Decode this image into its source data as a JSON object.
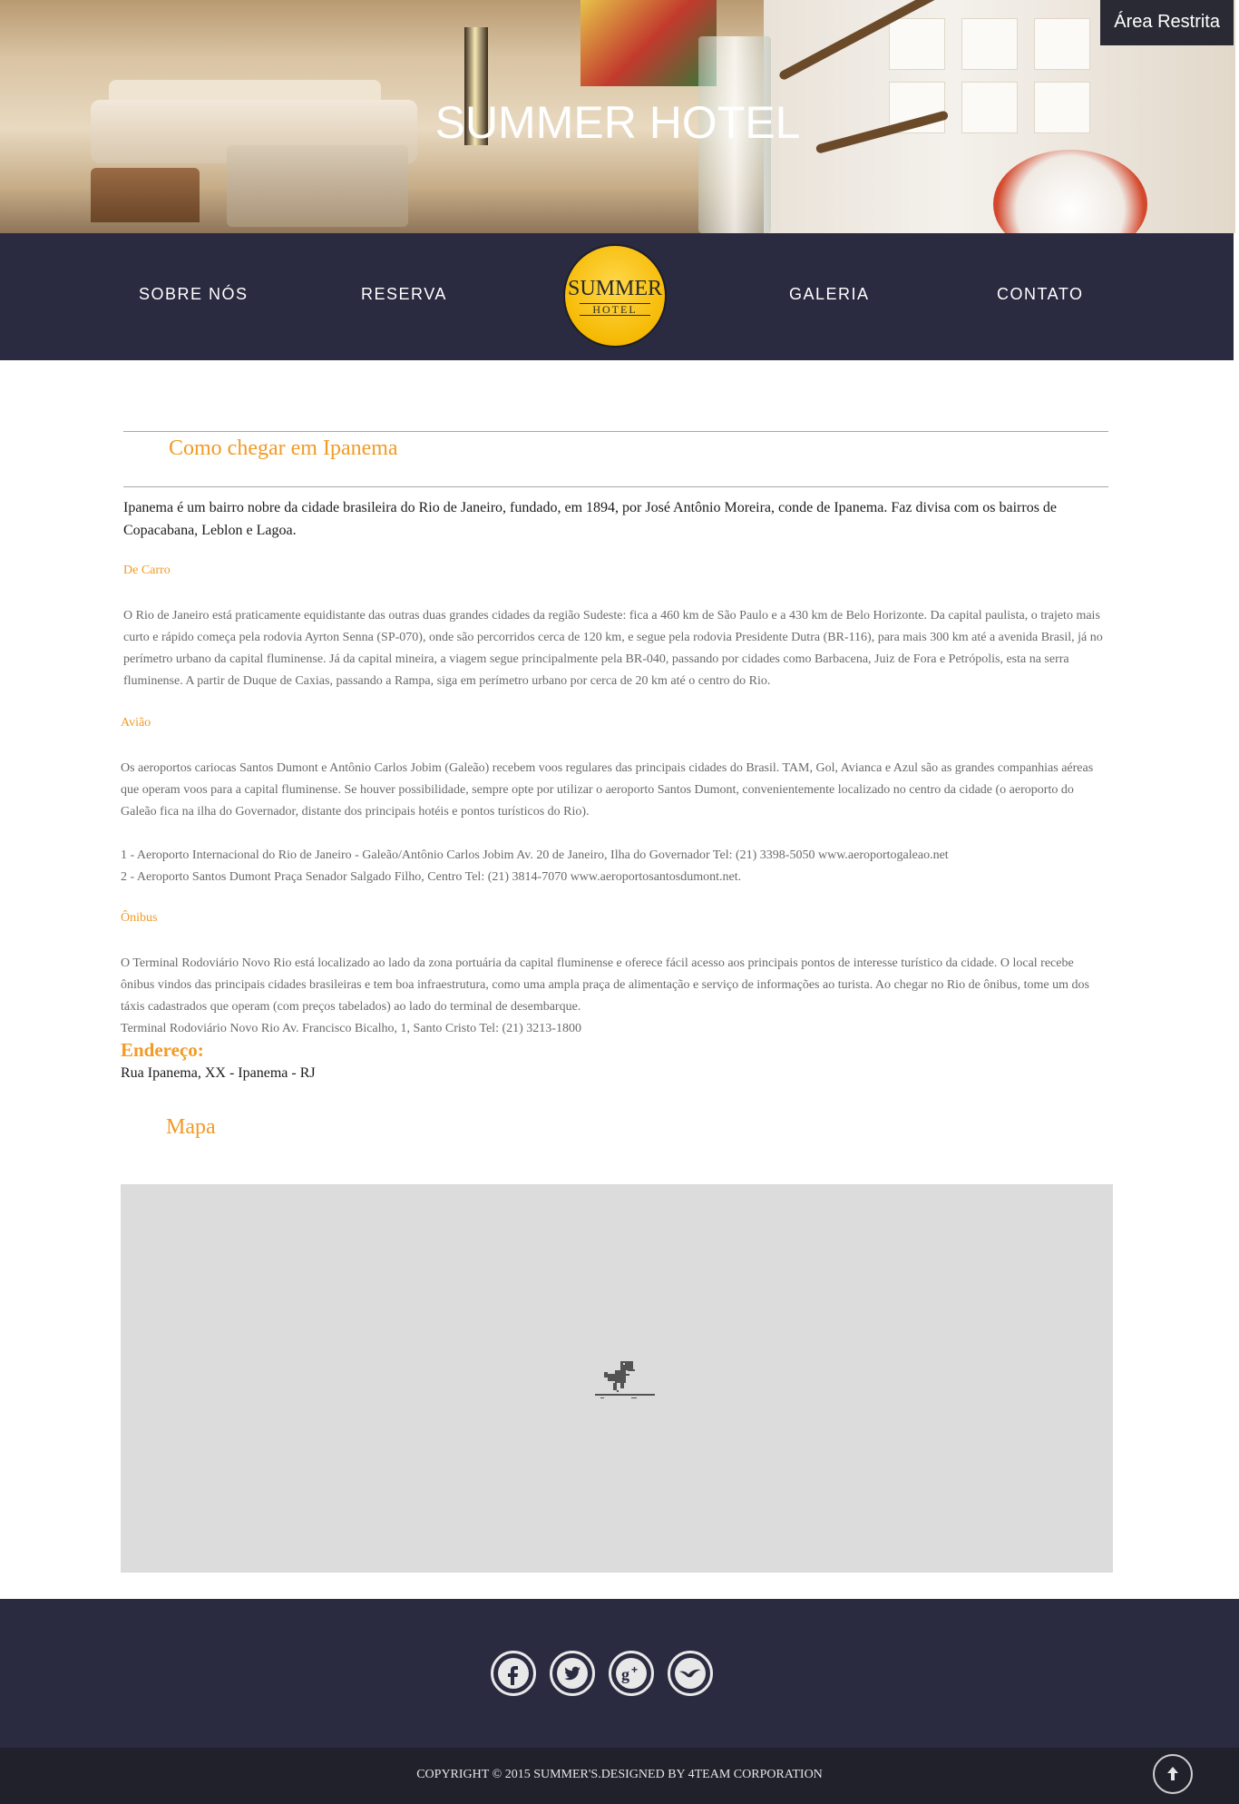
{
  "header": {
    "title": "SUMMER HOTEL",
    "restricted_link": "Área Restrita"
  },
  "nav": {
    "items": [
      {
        "label": "SOBRE NÓS"
      },
      {
        "label": "RESERVA"
      },
      {
        "label": "GALERIA"
      },
      {
        "label": "CONTATO"
      }
    ],
    "logo": {
      "line1": "SUMMER",
      "line2": "HOTEL"
    }
  },
  "main": {
    "heading": "Como chegar em Ipanema",
    "intro": "Ipanema é um bairro nobre da cidade brasileira do Rio de Janeiro, fundado, em 1894, por José Antônio Moreira, conde de Ipanema. Faz divisa com os bairros de Copacabana, Leblon e Lagoa.",
    "sections": [
      {
        "title": "De Carro",
        "text": "O Rio de Janeiro está praticamente equidistante das outras duas grandes cidades da região Sudeste: fica a 460 km de São Paulo e a 430 km de Belo Horizonte. Da capital paulista, o trajeto mais curto e rápido começa pela rodovia Ayrton Senna (SP-070), onde são percorridos cerca de 120 km, e segue pela rodovia Presidente Dutra (BR-116), para mais 300 km até a avenida Brasil, já no perímetro urbano da capital fluminense. Já da capital mineira, a viagem segue principalmente pela BR-040, passando por cidades como Barbacena, Juiz de Fora e Petrópolis, esta na serra fluminense. A partir de Duque de Caxias, passando a Rampa, siga em perímetro urbano por cerca de 20 km até o centro do Rio."
      },
      {
        "title": "Avião",
        "text": "Os aeroportos cariocas Santos Dumont e Antônio Carlos Jobim (Galeão) recebem voos regulares das principais cidades do Brasil. TAM, Gol, Avianca e Azul são as grandes companhias aéreas que operam voos para a capital fluminense. Se houver possibilidade, sempre opte por utilizar o aeroporto Santos Dumont, convenientemente localizado no centro da cidade (o aeroporto do Galeão fica na ilha do Governador, distante dos principais hotéis e pontos turísticos do Rio).",
        "list": [
          "1 - Aeroporto Internacional do Rio de Janeiro - Galeão/Antônio Carlos Jobim Av. 20 de Janeiro, Ilha do Governador Tel: (21) 3398-5050 www.aeroportogaleao.net",
          "2 - Aeroporto Santos Dumont Praça Senador Salgado Filho, Centro Tel: (21) 3814-7070 www.aeroportosantosdumont.net."
        ]
      },
      {
        "title": "Ônibus",
        "text": "O Terminal Rodoviário Novo Rio está localizado ao lado da zona portuária da capital fluminense e oferece fácil acesso aos principais pontos de interesse turístico da cidade. O local recebe ônibus vindos das principais cidades brasileiras e tem boa infraestrutura, como uma ampla praça de alimentação e serviço de informações ao turista. Ao chegar no Rio de ônibus, tome um dos táxis cadastrados que operam (com preços tabelados) ao lado do terminal de desembarque.",
        "extra": "Terminal Rodoviário Novo Rio Av. Francisco Bicalho, 1, Santo Cristo Tel: (21) 3213-1800"
      }
    ],
    "address_title": "Endereço:",
    "address": "Rua Ipanema, XX - Ipanema - RJ",
    "map_heading": "Mapa"
  },
  "footer": {
    "social": [
      "facebook-icon",
      "twitter-icon",
      "google-plus-icon",
      "bird-icon"
    ],
    "copyright": "COPYRIGHT © 2015 SUMMER'S.DESIGNED BY 4TEAM CORPORATION"
  },
  "colors": {
    "accent": "#f39a25",
    "nav_bg": "#2a2a40",
    "footer_bottom": "#21212c",
    "map_bg": "#dcdcdc"
  }
}
